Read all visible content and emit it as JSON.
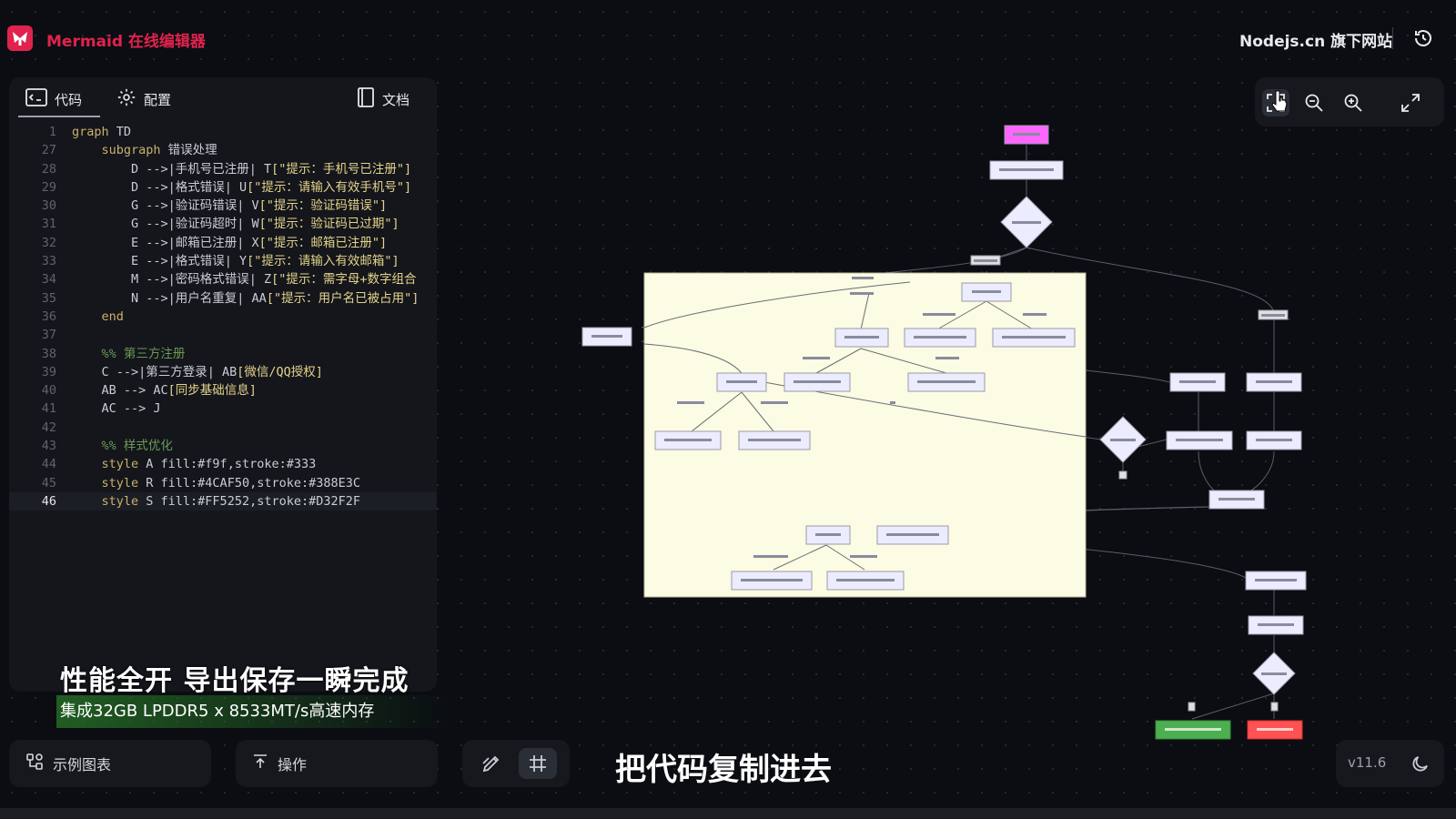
{
  "header": {
    "title": "Mermaid 在线编辑器",
    "site_link": "Nodejs.cn 旗下网站"
  },
  "editor": {
    "tabs": [
      {
        "label": "代码",
        "icon": "code-icon"
      },
      {
        "label": "配置",
        "icon": "gear-icon"
      },
      {
        "label": "文档",
        "icon": "book-icon"
      }
    ],
    "lines": [
      {
        "n": "1",
        "t": "graph TD"
      },
      {
        "n": "27",
        "t": "    subgraph 错误处理"
      },
      {
        "n": "28",
        "t": "        D -->|手机号已注册| T[\"提示：手机号已注册\"]"
      },
      {
        "n": "29",
        "t": "        D -->|格式错误| U[\"提示：请输入有效手机号\"]"
      },
      {
        "n": "30",
        "t": "        G -->|验证码错误| V[\"提示：验证码错误\"]"
      },
      {
        "n": "31",
        "t": "        G -->|验证码超时| W[\"提示：验证码已过期\"]"
      },
      {
        "n": "32",
        "t": "        E -->|邮箱已注册| X[\"提示：邮箱已注册\"]"
      },
      {
        "n": "33",
        "t": "        E -->|格式错误| Y[\"提示：请输入有效邮箱\"]"
      },
      {
        "n": "34",
        "t": "        M -->|密码格式错误| Z[\"提示：需字母+数字组合"
      },
      {
        "n": "35",
        "t": "        N -->|用户名重复| AA[\"提示：用户名已被占用\"]"
      },
      {
        "n": "36",
        "t": "    end"
      },
      {
        "n": "37",
        "t": ""
      },
      {
        "n": "38",
        "t": "    %% 第三方注册"
      },
      {
        "n": "39",
        "t": "    C -->|第三方登录| AB[微信/QQ授权]"
      },
      {
        "n": "40",
        "t": "    AB --> AC[同步基础信息]"
      },
      {
        "n": "41",
        "t": "    AC --> J"
      },
      {
        "n": "42",
        "t": ""
      },
      {
        "n": "43",
        "t": "    %% 样式优化"
      },
      {
        "n": "44",
        "t": "    style A fill:#f9f,stroke:#333"
      },
      {
        "n": "45",
        "t": "    style R fill:#4CAF50,stroke:#388E3C"
      },
      {
        "n": "46",
        "t": "    style S fill:#FF5252,stroke:#D32F2F"
      }
    ]
  },
  "captions": {
    "line1": "性能全开 导出保存一瞬完成",
    "line2": "集成32GB LPDDR5 x 8533MT/s高速内存",
    "line3": "把代码复制进去"
  },
  "bottom": {
    "examples": "示例图表",
    "actions": "操作",
    "version": "v11.6"
  },
  "colors": {
    "accent": "#e0234e",
    "start_node": "#ff66ff",
    "success_node": "#4CAF50",
    "fail_node": "#FF5252",
    "subgraph_fill": "#fcfbe3"
  }
}
